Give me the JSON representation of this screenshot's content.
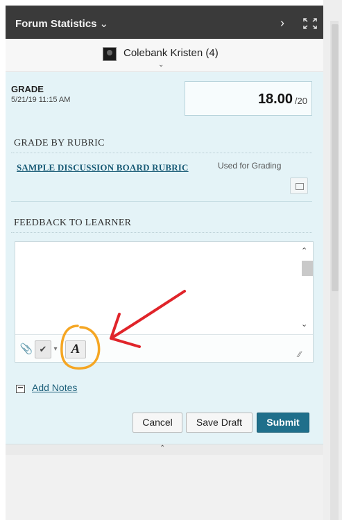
{
  "header": {
    "title": "Forum Statistics",
    "title_icon": "chevron-down-icon",
    "next_icon": "chevron-right-icon",
    "expand_icon": "expand-icon"
  },
  "user": {
    "name": "Colebank Kristen (4)",
    "avatar_icon": "avatar-icon",
    "selector_icon": "chevron-down-icon"
  },
  "grade": {
    "label": "GRADE",
    "date": "5/21/19 11:15 AM",
    "value": "18.00",
    "max": "/20"
  },
  "rubric": {
    "heading": "GRADE BY RUBRIC",
    "link": "SAMPLE DISCUSSION BOARD RUBRIC",
    "status": "Used for Grading",
    "open_icon": "popup-window-icon"
  },
  "feedback": {
    "heading": "FEEDBACK TO LEARNER",
    "content": "",
    "toolbar": {
      "attach_icon": "paperclip-icon",
      "spell_icon": "spellcheck-icon",
      "text_editor_label": "A"
    }
  },
  "notes": {
    "label": "Add Notes",
    "icon": "notes-icon"
  },
  "actions": {
    "cancel": "Cancel",
    "save_draft": "Save Draft",
    "submit": "Submit"
  },
  "colors": {
    "header_bg": "#3a3a3a",
    "panel_bg": "#e4f3f7",
    "link": "#1a5c77",
    "submit_bg": "#1f6f8b",
    "annotation_arrow": "#e0242a",
    "annotation_circle": "#f5a623"
  }
}
